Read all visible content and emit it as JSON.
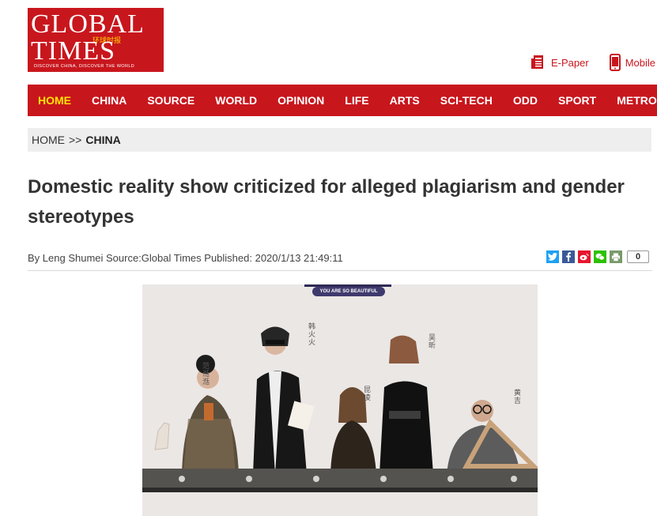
{
  "logo": {
    "line1": "GLOBAL",
    "line2": "TIMES",
    "chinese": "环球时报",
    "tagline": "DISCOVER CHINA, DISCOVER THE WORLD"
  },
  "top_links": [
    {
      "label": "E-Paper",
      "icon": "newspaper-icon"
    },
    {
      "label": "Mobile",
      "icon": "mobile-phone-icon"
    }
  ],
  "nav": {
    "items": [
      "HOME",
      "CHINA",
      "SOURCE",
      "WORLD",
      "OPINION",
      "LIFE",
      "ARTS",
      "SCI-TECH",
      "ODD",
      "SPORT",
      "METRO"
    ],
    "active": "HOME"
  },
  "breadcrumb": {
    "home": "HOME",
    "separator": ">>",
    "current": "CHINA"
  },
  "article": {
    "title": "Domestic reality show criticized for alleged plagiarism and gender stereotypes",
    "byline": "By Leng Shumei Source:Global Times Published: 2020/1/13 21:49:11"
  },
  "share": {
    "buttons": [
      {
        "name": "twitter-icon",
        "color": "#1da1f2",
        "glyph": "t"
      },
      {
        "name": "facebook-icon",
        "color": "#3b5998",
        "glyph": "f"
      },
      {
        "name": "weibo-icon",
        "color": "#e6162d",
        "glyph": "w"
      },
      {
        "name": "wechat-icon",
        "color": "#2dc100",
        "glyph": "c"
      },
      {
        "name": "print-icon",
        "color": "#7a9a6a",
        "glyph": "p"
      }
    ],
    "count": "0"
  },
  "photo": {
    "pill_text": "YOU ARE SO BEAUTIFUL",
    "names": [
      "范湉湉",
      "韩火火",
      "昆凌",
      "吴昕",
      "黄吉"
    ]
  },
  "colors": {
    "brand_red": "#c8161d",
    "nav_active": "#ffe400"
  }
}
